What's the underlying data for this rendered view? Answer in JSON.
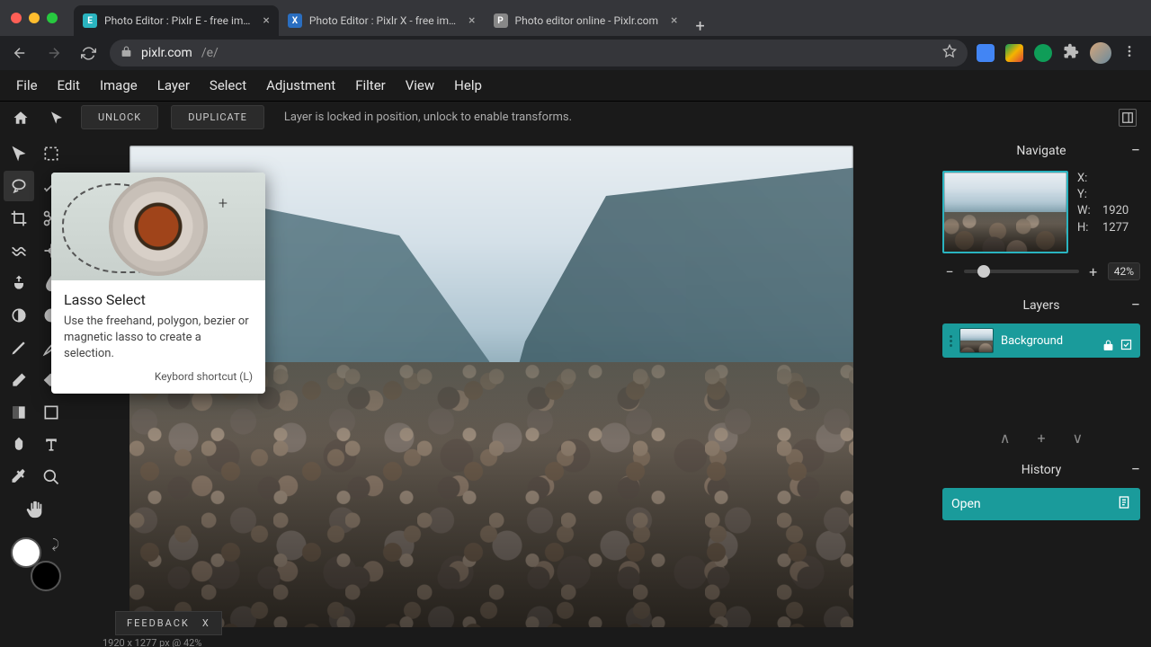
{
  "browser": {
    "tabs": [
      {
        "title": "Photo Editor : Pixlr E - free im…",
        "active": true
      },
      {
        "title": "Photo Editor : Pixlr X - free im…",
        "active": false
      },
      {
        "title": "Photo editor online - Pixlr.com",
        "active": false
      }
    ],
    "url_domain": "pixlr.com",
    "url_path": "/e/"
  },
  "menu": [
    "File",
    "Edit",
    "Image",
    "Layer",
    "Select",
    "Adjustment",
    "Filter",
    "View",
    "Help"
  ],
  "options": {
    "unlock": "UNLOCK",
    "duplicate": "DUPLICATE",
    "message": "Layer is locked in position, unlock to enable transforms."
  },
  "tooltip": {
    "title": "Lasso Select",
    "desc": "Use the freehand, polygon, bezier or magnetic lasso to create a selection.",
    "shortcut": "Keybord shortcut (L)"
  },
  "navigate": {
    "title": "Navigate",
    "x_label": "X:",
    "y_label": "Y:",
    "w_label": "W:",
    "h_label": "H:",
    "w": "1920",
    "h": "1277",
    "zoom": "42%"
  },
  "layers": {
    "title": "Layers",
    "item": "Background"
  },
  "history": {
    "title": "History",
    "item": "Open"
  },
  "feedback": {
    "label": "FEEDBACK",
    "close": "X"
  },
  "status": "1920 x 1277 px @ 42%"
}
